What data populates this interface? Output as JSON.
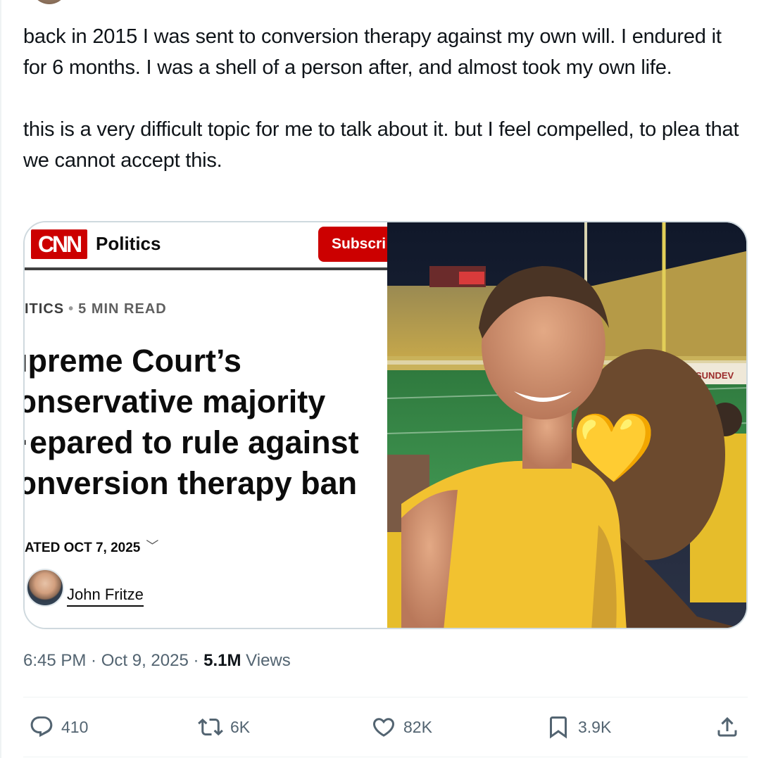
{
  "tweet": {
    "paragraph_1": "back in 2015 I was sent to conversion therapy against my own will. I endured it for 6 months. I was a shell of a person after, and almost took my own life.",
    "paragraph_2": "this is a very difficult topic for me to talk about it. but I feel compelled, to plea that we cannot accept this."
  },
  "cnn_card": {
    "logo_text": "CNN",
    "section": "Politics",
    "subscribe_label": "Subscri",
    "category": "ITICS",
    "read_time": "5 MIN READ",
    "headline_lines": [
      "ıpreme Court’s",
      "ɔnservative majority",
      "·epared to rule against",
      "ɔnversion therapy ban"
    ],
    "updated": "ATED OCT 7, 2025",
    "author": "John Fritze"
  },
  "photo": {
    "sign_text": "SUNDEV",
    "emoji": "💛"
  },
  "meta": {
    "time": "6:45 PM",
    "date": "Oct 9, 2025",
    "views_count": "5.1M",
    "views_label": "Views"
  },
  "actions": {
    "replies": "410",
    "reposts": "6K",
    "likes": "82K",
    "bookmarks": "3.9K"
  },
  "colors": {
    "text": "#0f1419",
    "secondary": "#536471",
    "cnn_red": "#cc0000",
    "border": "#cfd9de",
    "jersey_gold": "#f2c230"
  }
}
